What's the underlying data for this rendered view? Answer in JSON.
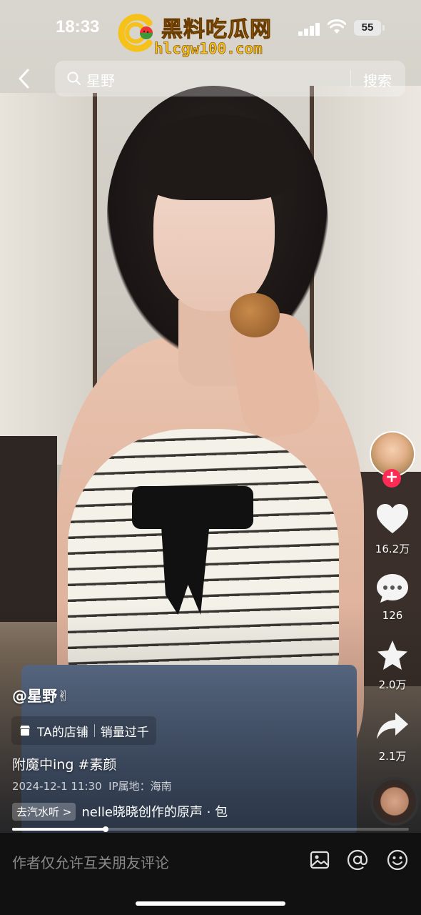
{
  "status_bar": {
    "time": "18:33",
    "battery": "55"
  },
  "watermark": {
    "title": "黑料吃瓜网",
    "url": "hlcgw100.com"
  },
  "search": {
    "query": "星野",
    "button_label": "搜索"
  },
  "actions": {
    "like_count": "16.2万",
    "comment_count": "126",
    "favorite_count": "2.0万",
    "share_count": "2.1万",
    "follow_symbol": "+"
  },
  "caption": {
    "author": "@星野✌",
    "shop_label": "TA的店铺",
    "shop_sales": "销量过千",
    "description": "附魔中ing #素颜",
    "date": "2024-12-1 11:30",
    "ip_location": "IP属地：海南",
    "music_tag": "去汽水听 >",
    "music_title": "nelle晓晓创作的原声 · 包"
  },
  "progress": {
    "fraction": 0.235
  },
  "comment_bar": {
    "placeholder": "作者仅允许互关朋友评论"
  },
  "colors": {
    "accent": "#fe2c55",
    "watermark": "#f6c21a"
  }
}
